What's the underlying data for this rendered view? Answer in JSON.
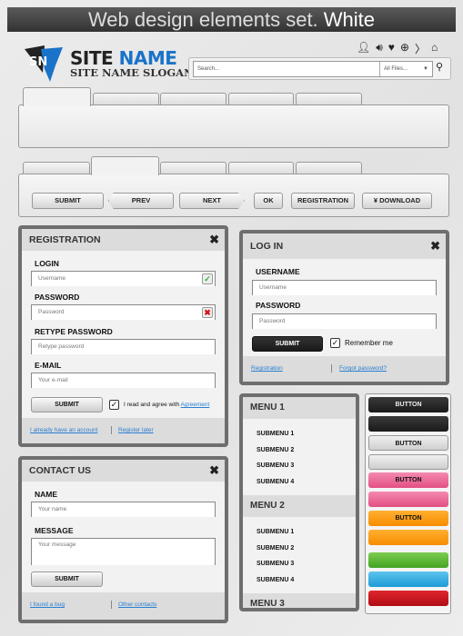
{
  "title": {
    "main": "Web design elements set.",
    "accent": "White"
  },
  "logo": {
    "letters": "SN",
    "name_part1": "SITE",
    "name_part2": "NAME",
    "slogan": "SITE NAME SLOGAN"
  },
  "top_icons": [
    "user-icon",
    "speaker-icon",
    "heart-icon",
    "globe-icon",
    "rss-icon",
    "home-icon"
  ],
  "search": {
    "placeholder": "Search...",
    "filter": "All Files..."
  },
  "buttons": {
    "submit": "SUBMIT",
    "prev": "PREV",
    "next": "NEXT",
    "ok": "OK",
    "registration": "REGISTRATION",
    "download": "DOWNLOAD"
  },
  "registration": {
    "title": "REGISTRATION",
    "login_label": "LOGIN",
    "login_placeholder": "Username",
    "password_label": "PASSWORD",
    "password_placeholder": "Password",
    "retype_label": "RETYPE PASSWORD",
    "retype_placeholder": "Retype password",
    "email_label": "E-MAIL",
    "email_placeholder": "Your e-mail",
    "submit": "SUBMIT",
    "agree_text": "I read and agree with",
    "agree_link": "Agreement",
    "link1": "I already have an account",
    "link2": "Register later"
  },
  "login": {
    "title": "LOG IN",
    "username_label": "USERNAME",
    "username_placeholder": "Username",
    "password_label": "PASSWORD",
    "password_placeholder": "Password",
    "submit": "SUBMIT",
    "remember": "Remember me",
    "link1": "Registration",
    "link2": "Forgot password?"
  },
  "contact": {
    "title": "CONTACT US",
    "name_label": "NAME",
    "name_placeholder": "Your name",
    "message_label": "MESSAGE",
    "message_placeholder": "Your message",
    "submit": "SUBMIT",
    "link1": "I found a bug",
    "link2": "Other contacts"
  },
  "menu": {
    "menus": [
      {
        "label": "MENU 1",
        "items": [
          "SUBMENU 1",
          "SUBMENU 2",
          "SUBMENU 3",
          "SUBMENU 4"
        ]
      },
      {
        "label": "MENU 2",
        "items": [
          "SUBMENU 1",
          "SUBMENU 2",
          "SUBMENU 3",
          "SUBMENU 4"
        ]
      },
      {
        "label": "MENU 3",
        "items": []
      }
    ]
  },
  "color_buttons": {
    "label": "BUTTON",
    "colors": {
      "black": "#222222",
      "silver": "#d6d6d6",
      "pink": "#ea5a8c",
      "orange": "#fb9200",
      "green": "#55b42f",
      "blue": "#2aa6dd",
      "red": "#c5121a",
      "accent_blue": "#1a73c9"
    }
  }
}
